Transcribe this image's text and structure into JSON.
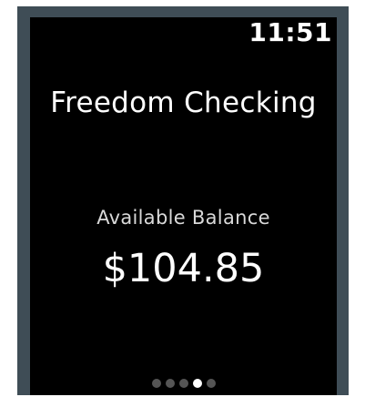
{
  "status_bar": {
    "time": "11:51"
  },
  "account": {
    "name": "Freedom Checking",
    "balance_label": "Available Balance",
    "balance_value": "$104.85"
  },
  "pagination": {
    "count": 5,
    "active_index": 3
  },
  "colors": {
    "bezel": "#3f4d56",
    "screen": "#000000",
    "text": "#ffffff",
    "dot_inactive": "#555555",
    "dot_active": "#ffffff"
  }
}
